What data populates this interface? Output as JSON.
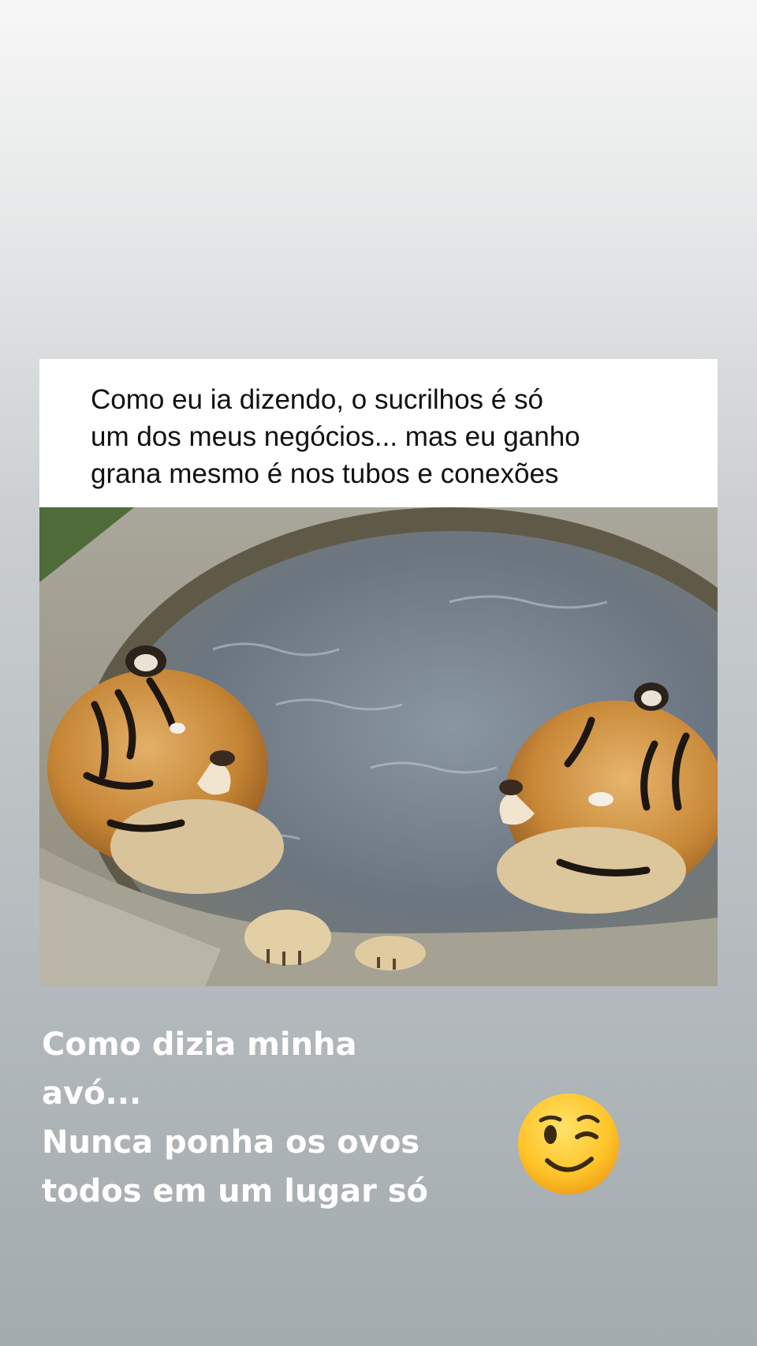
{
  "meme": {
    "caption_lines": [
      "Como eu ia dizendo, o sucrilhos é só",
      "um dos meus negócios... mas eu ganho",
      "grana mesmo é nos tubos e conexões"
    ],
    "photo_subject": "two-tigers-in-water-tank"
  },
  "story": {
    "text_lines": [
      "Como dizia minha",
      "avó...",
      "Nunca ponha os ovos",
      "todos em um lugar só"
    ],
    "sticker": "winking-face-emoji"
  },
  "colors": {
    "background_top": "#f7f7f7",
    "background_bottom": "#a3abae",
    "story_text": "#ffffff",
    "caption_text": "#111111",
    "water": "#6f7a86",
    "tiger_orange": "#c98a3a"
  }
}
